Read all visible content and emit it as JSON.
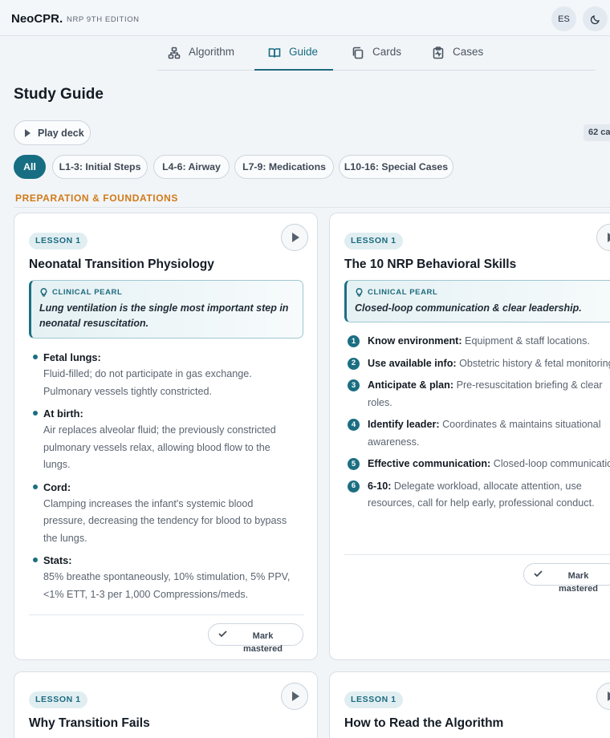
{
  "app": {
    "brand": "NeoCPR.",
    "edition": "NRP 9TH EDITION",
    "language_button": "ES"
  },
  "tabs": [
    {
      "label": "Algorithm",
      "icon": "algorithm-tree-icon",
      "active": false
    },
    {
      "label": "Guide",
      "icon": "book-open-icon",
      "active": true
    },
    {
      "label": "Cards",
      "icon": "cards-stack-icon",
      "active": false
    },
    {
      "label": "Cases",
      "icon": "clipboard-pulse-icon",
      "active": false
    }
  ],
  "page": {
    "title": "Study Guide",
    "play_deck_label": "Play deck",
    "count_badge": "62 ca"
  },
  "filters": [
    {
      "label": "All",
      "active": true
    },
    {
      "label": "L1-3: Initial Steps",
      "active": false
    },
    {
      "label": "L4-6: Airway",
      "active": false
    },
    {
      "label": "L7-9: Medications",
      "active": false
    },
    {
      "label": "L10-16: Special Cases",
      "active": false
    }
  ],
  "section": {
    "label": "PREPARATION & FOUNDATIONS"
  },
  "cards": [
    {
      "lesson": "LESSON 1",
      "title": "Neonatal Transition Physiology",
      "pearl_label": "CLINICAL PEARL",
      "pearl_text": "Lung ventilation is the single most important step in neonatal resuscitation.",
      "bullets": [
        {
          "head": "Fetal lungs:",
          "body": "Fluid-filled; do not participate in gas exchange. Pulmonary vessels tightly constricted."
        },
        {
          "head": "At birth:",
          "body": "Air replaces alveolar fluid; the previously constricted pulmonary vessels relax, allowing blood flow to the lungs."
        },
        {
          "head": "Cord:",
          "body": "Clamping increases the infant's systemic blood pressure, decreasing the tendency for blood to bypass the lungs."
        },
        {
          "head": "Stats:",
          "body": "85% breathe spontaneously, 10% stimulation, 5% PPV, <1% ETT, 1-3 per 1,000 Compressions/meds."
        }
      ],
      "mastered_label": "Mark mastered"
    },
    {
      "lesson": "LESSON 1",
      "title": "The 10 NRP Behavioral Skills",
      "pearl_label": "CLINICAL PEARL",
      "pearl_text": "Closed-loop communication & clear leadership.",
      "items": [
        {
          "num": "1",
          "head": "Know environment:",
          "body": "Equipment & staff locations."
        },
        {
          "num": "2",
          "head": "Use available info:",
          "body": "Obstetric history & fetal monitoring."
        },
        {
          "num": "3",
          "head": "Anticipate & plan:",
          "body": "Pre-resuscitation briefing & clear roles."
        },
        {
          "num": "4",
          "head": "Identify leader:",
          "body": "Coordinates & maintains situational awareness."
        },
        {
          "num": "5",
          "head": "Effective communication:",
          "body": "Closed-loop communication."
        },
        {
          "num": "6",
          "head": "6-10:",
          "body": "Delegate workload, allocate attention, use resources, call for help early, professional conduct."
        }
      ],
      "mastered_label": "Mark mastered"
    },
    {
      "lesson": "LESSON 1",
      "title": "Why Transition Fails"
    },
    {
      "lesson": "LESSON 1",
      "title": "How to Read the Algorithm"
    }
  ]
}
